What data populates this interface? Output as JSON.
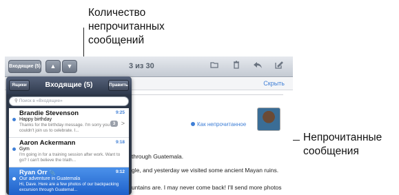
{
  "callouts": {
    "unread_count_line1": "Количество",
    "unread_count_line2": "непрочитанных",
    "unread_count_line3": "сообщений",
    "unread_messages_line1": "Непрочитанные",
    "unread_messages_line2": "сообщения"
  },
  "toolbar": {
    "inbox_button": "Входящие (5)",
    "up_arrow": "▲",
    "down_arrow": "▼",
    "message_counter": "3 из 30",
    "icons": [
      "folder-move-icon",
      "trash-icon",
      "reply-icon",
      "compose-icon"
    ]
  },
  "message_header": {
    "hide_link": "Скрыть",
    "mark_unread": "Как непрочитанное"
  },
  "message_body": {
    "line1": "through Guatemala.",
    "line2": "gle, and yesterday we visited some ancient Mayan ruins.",
    "line3": "untains are. I may never come back! I'll send more photos"
  },
  "popover": {
    "mailboxes_button": "Ящики",
    "title": "Входящие (5)",
    "edit_button": "Править",
    "search_placeholder": "Поиск в «Входящие»",
    "messages": [
      {
        "sender": "Brandie Stevenson",
        "time": "9:25",
        "subject": "Happy birthday",
        "preview": "Thanks for the birthday message. I'm sorry you couldn't join us to celebrate. I...",
        "thread_count": "3",
        "unread": true,
        "selected": false
      },
      {
        "sender": "Aaron Ackermann",
        "time": "9:18",
        "subject": "Gym",
        "preview": "I'm going in for a training session after work. Want to go? I can't believe the triath...",
        "unread": true,
        "selected": false
      },
      {
        "sender": "Ryan Orr",
        "time": "9:12",
        "subject": "Our adventure in Guatemala",
        "preview": "Hi, Dave. Here are a few photos of our backpacking excursion through Guatemal...",
        "unread": true,
        "selected": true
      }
    ]
  }
}
